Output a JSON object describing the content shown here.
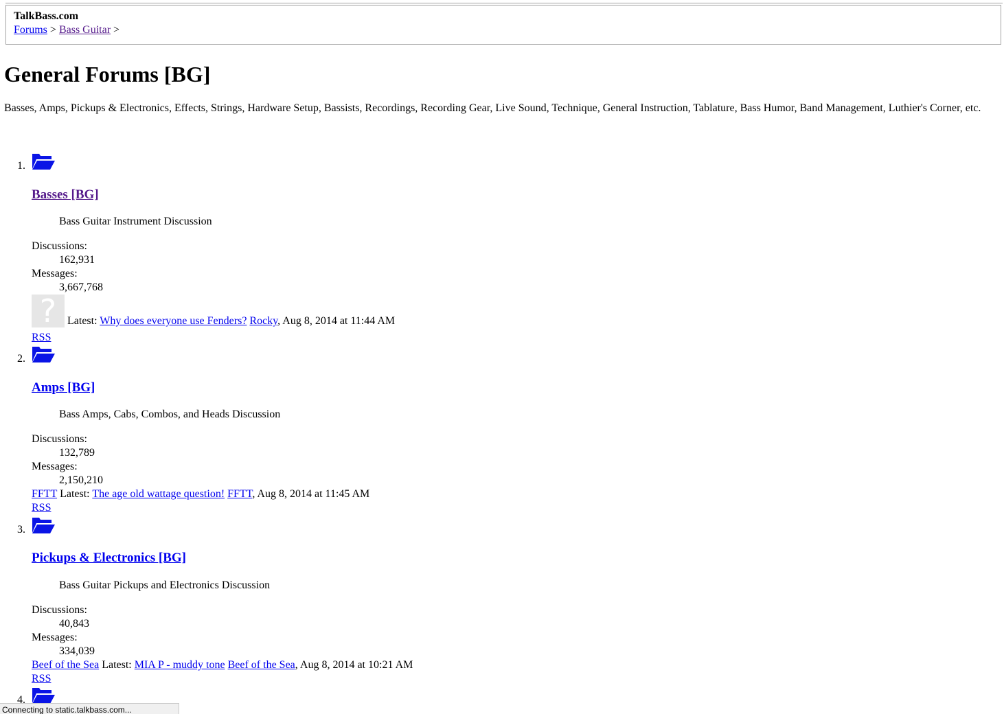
{
  "header": {
    "site_title": "TalkBass.com",
    "breadcrumb": [
      {
        "label": "Forums"
      },
      {
        "label": "Bass Guitar"
      }
    ],
    "separator": ">"
  },
  "page": {
    "title": "General Forums [BG]",
    "description": "Basses, Amps, Pickups & Electronics, Effects, Strings, Hardware Setup, Bassists, Recordings, Recording Gear, Live Sound, Technique, General Instruction, Tablature, Bass Humor, Band Management, Luthier's Corner, etc."
  },
  "labels": {
    "discussions": "Discussions:",
    "messages": "Messages:",
    "latest": "Latest:",
    "rss": "RSS",
    "avatar_glyph": "?"
  },
  "forums": [
    {
      "number": "1.",
      "title": "Basses [BG]",
      "description": "Bass Guitar Instrument Discussion",
      "discussions": "162,931",
      "messages": "3,667,768",
      "latest_thread": "Why does everyone use Fenders?",
      "latest_user": "Rocky",
      "latest_date": ", Aug 8, 2014 at 11:44 AM"
    },
    {
      "number": "2.",
      "title": "Amps [BG]",
      "description": "Bass Amps, Cabs, Combos, and Heads Discussion",
      "discussions": "132,789",
      "messages": "2,150,210",
      "avatar_user": "FFTT",
      "latest_thread": "The age old wattage question!",
      "latest_user": "FFTT",
      "latest_date": ", Aug 8, 2014 at 11:45 AM"
    },
    {
      "number": "3.",
      "title": "Pickups & Electronics [BG]",
      "description": "Bass Guitar Pickups and Electronics Discussion",
      "discussions": "40,843",
      "messages": "334,039",
      "avatar_user": "Beef of the Sea",
      "latest_thread": "MIA P - muddy tone",
      "latest_user": "Beef of the Sea",
      "latest_date": ", Aug 8, 2014 at 10:21 AM"
    },
    {
      "number": "4."
    }
  ],
  "status_bar": "Connecting to static.talkbass.com...",
  "colors": {
    "link": "#0000ee",
    "visited_link": "#551a8b",
    "folder_icon": "#0a14e6"
  },
  "icons": {
    "forum": "folder-open-icon",
    "avatar": "default-avatar-icon"
  }
}
